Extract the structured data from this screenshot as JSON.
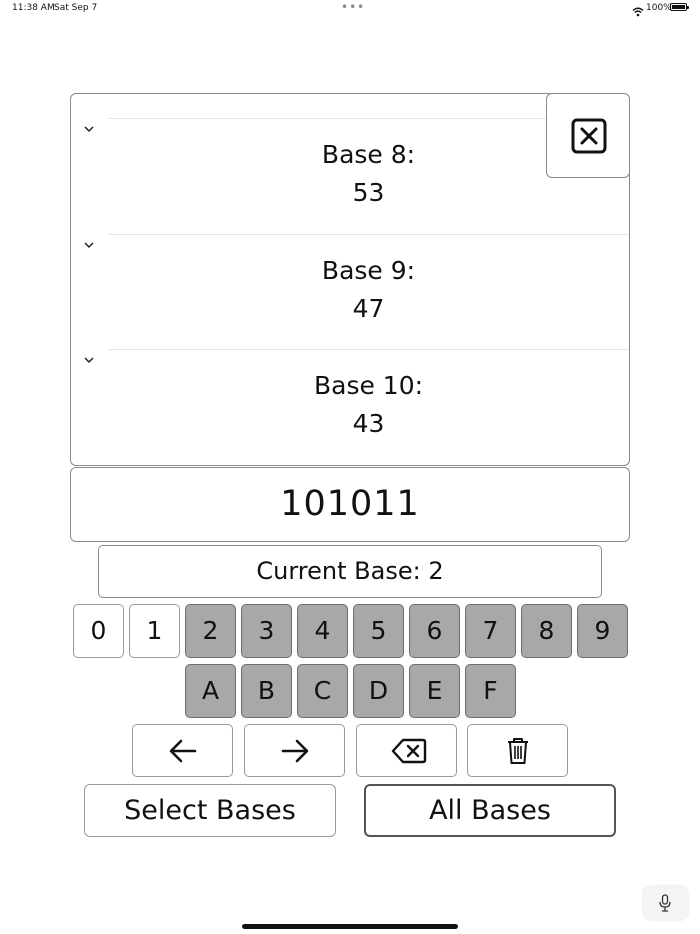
{
  "status_bar": {
    "time": "11:38 AM",
    "date": "Sat Sep 7",
    "battery_text": "100%"
  },
  "results": [
    {
      "label": "Base 8:",
      "value": "53"
    },
    {
      "label": "Base 9:",
      "value": "47"
    },
    {
      "label": "Base 10:",
      "value": "43"
    }
  ],
  "input": {
    "value": "101011"
  },
  "current_base_label": "Current Base: 2",
  "keypad": {
    "row1": [
      "0",
      "1",
      "2",
      "3",
      "4",
      "5",
      "6",
      "7",
      "8",
      "9"
    ],
    "row2": [
      "A",
      "B",
      "C",
      "D",
      "E",
      "F"
    ],
    "enabled_keys": [
      "0",
      "1"
    ]
  },
  "tools": {
    "icons": [
      "arrow-left-icon",
      "arrow-right-icon",
      "backspace-icon",
      "trash-icon"
    ]
  },
  "bottom": {
    "select_bases": "Select Bases",
    "all_bases": "All Bases"
  }
}
